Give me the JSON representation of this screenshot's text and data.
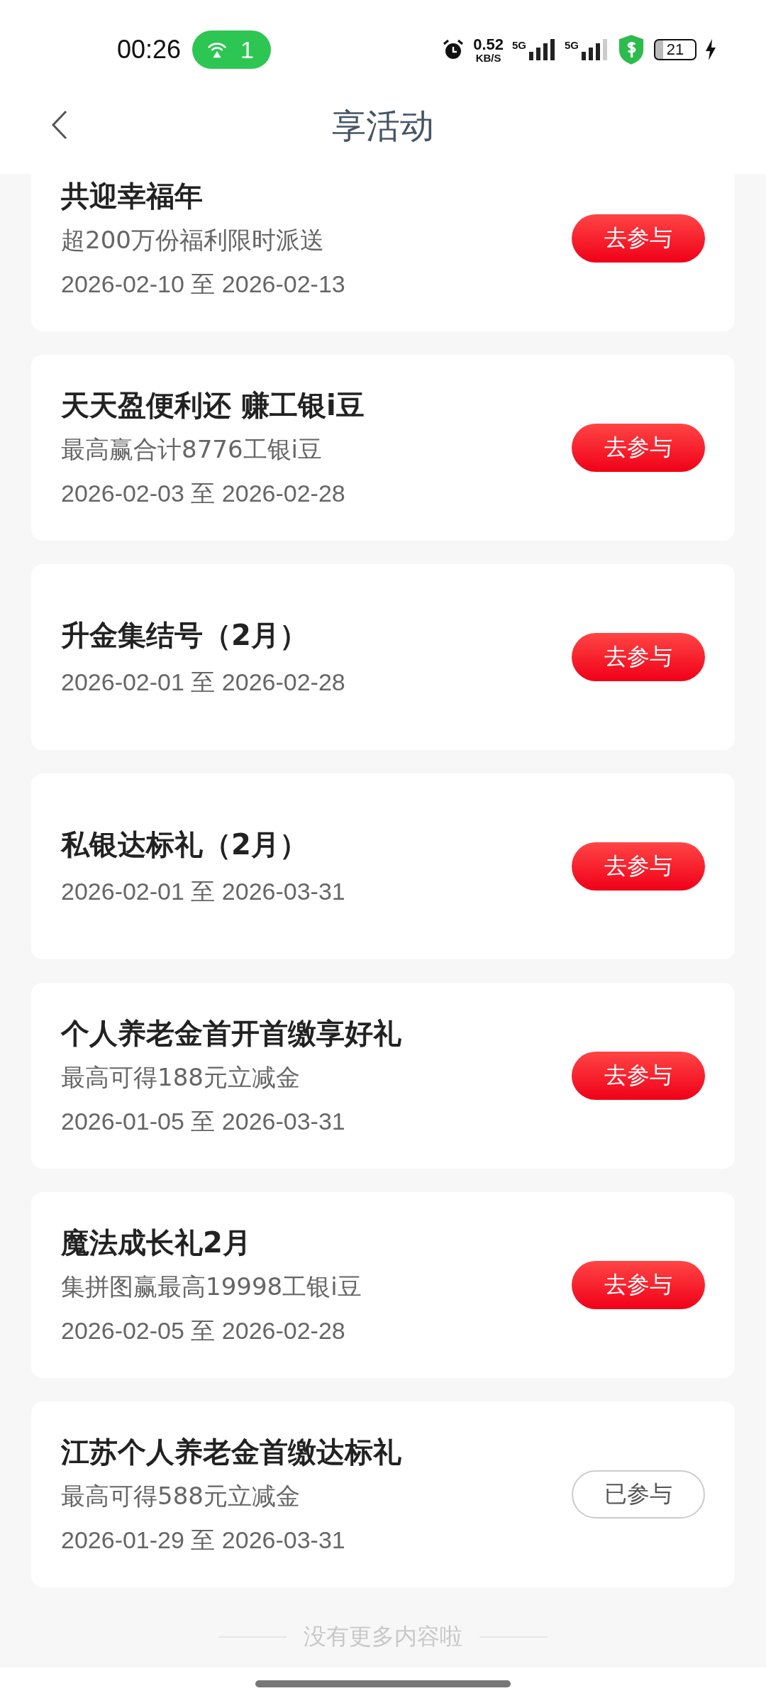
{
  "status_bar": {
    "time": "00:26",
    "hotspot_count": "1",
    "net_speed": "0.52",
    "net_unit": "KB/S",
    "sim_1": "5G",
    "sim_2": "5G",
    "battery": "21"
  },
  "header": {
    "title": "享活动"
  },
  "activities": [
    {
      "title": "共迎幸福年",
      "subtitle": "超200万份福利限时派送",
      "period": "2026-02-10 至 2026-02-13",
      "button": "去参与",
      "joined": false
    },
    {
      "title": "天天盈便利还 赚工银i豆",
      "subtitle": "最高赢合计8776工银i豆",
      "period": "2026-02-03 至 2026-02-28",
      "button": "去参与",
      "joined": false
    },
    {
      "title": "升金集结号（2月）",
      "period": "2026-02-01 至 2026-02-28",
      "button": "去参与",
      "joined": false
    },
    {
      "title": "私银达标礼（2月）",
      "period": "2026-02-01 至 2026-03-31",
      "button": "去参与",
      "joined": false
    },
    {
      "title": "个人养老金首开首缴享好礼",
      "subtitle": "最高可得188元立减金",
      "period": "2026-01-05 至 2026-03-31",
      "button": "去参与",
      "joined": false
    },
    {
      "title": "魔法成长礼2月",
      "subtitle": "集拼图赢最高19998工银i豆",
      "period": "2026-02-05 至 2026-02-28",
      "button": "去参与",
      "joined": false
    },
    {
      "title": "江苏个人养老金首缴达标礼",
      "subtitle": "最高可得588元立减金",
      "period": "2026-01-29 至 2026-03-31",
      "button": "已参与",
      "joined": true
    }
  ],
  "footer": "没有更多内容啦"
}
